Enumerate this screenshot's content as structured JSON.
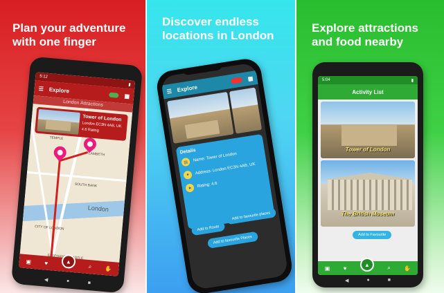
{
  "colors": {
    "left_bg": "#d81e22",
    "mid_bg": "#35e6ec",
    "right_bg": "#28bd2e",
    "accent_blue": "#29a4de"
  },
  "left": {
    "headline": "Plan your adventure\nwith one finger",
    "status_time": "5:12",
    "appbar_title": "Explore",
    "banner": "London Attractions",
    "card": {
      "name": "Tower of London",
      "address": "London EC3N 4AB, UK",
      "rating": "4.6 Rating"
    },
    "map_labels": [
      "TEMPLE",
      "LAMBETH",
      "SOUTH BANK",
      "CITY OF LONDON",
      "ELEPHANT & CASTLE"
    ],
    "map_city": "London",
    "nav": {
      "map": "map-icon",
      "fav": "heart-icon",
      "go": "navigate-icon",
      "search": "search-icon",
      "like": "thumb-icon"
    }
  },
  "mid": {
    "headline": "Discover endless\nlocations in London",
    "appbar_title": "Explore",
    "details": {
      "heading": "Details",
      "name": "Name: Tower of London",
      "address": "Address: London EC3N 4AB, UK",
      "rating": "Rating: 4.6"
    },
    "buttons": {
      "route": "Add to Route",
      "fav_places": "Add to favourite places",
      "fav_places2": "Add to favourite Places"
    }
  },
  "right": {
    "headline": "Explore attractions\nand food nearby",
    "status_time": "5:04",
    "appbar_title": "Activity List",
    "cards": [
      "Tower of London",
      "The British Museum"
    ],
    "fav_button": "Add to Favourite"
  }
}
